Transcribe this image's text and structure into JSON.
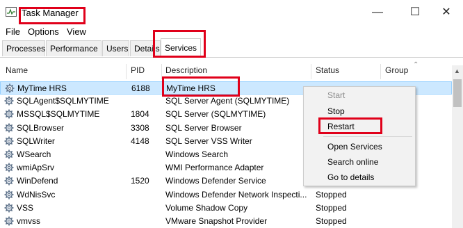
{
  "window": {
    "title": "Task Manager",
    "controls": {
      "minimize": "—",
      "maximize": "☐",
      "close": "✕"
    }
  },
  "menu": [
    "File",
    "Options",
    "View"
  ],
  "tabs": [
    {
      "label": "Processes"
    },
    {
      "label": "Performance"
    },
    {
      "label": "Users"
    },
    {
      "label": "Details"
    },
    {
      "label": "Services",
      "active": true
    }
  ],
  "columns": {
    "name": "Name",
    "pid": "PID",
    "description": "Description",
    "status": "Status",
    "group": "Group"
  },
  "rows": [
    {
      "name": "MyTime HRS",
      "pid": "6188",
      "description": "MyTime  HRS",
      "status": "",
      "selected": true
    },
    {
      "name": "SQLAgent$SQLMYTIME",
      "pid": "",
      "description": "SQL Server Agent (SQLMYTIME)",
      "status": ""
    },
    {
      "name": "MSSQL$SQLMYTIME",
      "pid": "1804",
      "description": "SQL Server (SQLMYTIME)",
      "status": ""
    },
    {
      "name": "SQLBrowser",
      "pid": "3308",
      "description": "SQL Server Browser",
      "status": ""
    },
    {
      "name": "SQLWriter",
      "pid": "4148",
      "description": "SQL Server VSS Writer",
      "status": ""
    },
    {
      "name": "WSearch",
      "pid": "",
      "description": "Windows Search",
      "status": ""
    },
    {
      "name": "wmiApSrv",
      "pid": "",
      "description": "WMI Performance Adapter",
      "status": ""
    },
    {
      "name": "WinDefend",
      "pid": "1520",
      "description": "Windows Defender Service",
      "status": ""
    },
    {
      "name": "WdNisSvc",
      "pid": "",
      "description": "Windows Defender Network Inspecti...",
      "status": "Stopped"
    },
    {
      "name": "VSS",
      "pid": "",
      "description": "Volume Shadow Copy",
      "status": "Stopped"
    },
    {
      "name": "vmvss",
      "pid": "",
      "description": "VMware Snapshot Provider",
      "status": "Stopped"
    }
  ],
  "context_menu": {
    "start": "Start",
    "stop": "Stop",
    "restart": "Restart",
    "open_services": "Open Services",
    "search_online": "Search online",
    "go_to_details": "Go to details"
  },
  "colors": {
    "highlight": "#e0001a",
    "selection": "#cce8ff",
    "menu_bg": "#f2f2f2"
  },
  "icons": {
    "app": "task-manager-icon",
    "service": "gear-icon"
  }
}
